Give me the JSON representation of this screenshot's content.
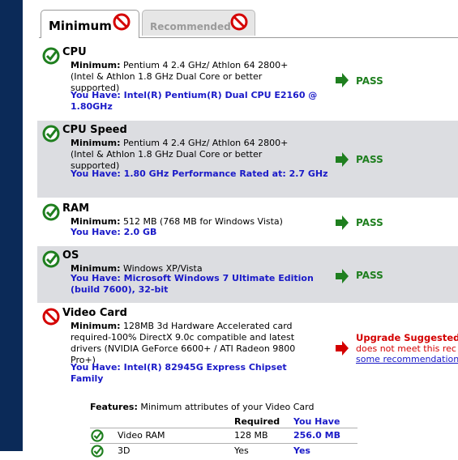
{
  "tabs": [
    {
      "label": "Minimum",
      "active": true,
      "icon": "no-icon"
    },
    {
      "label": "Recommended",
      "active": false,
      "icon": "no-icon"
    }
  ],
  "requirements": [
    {
      "title": "CPU",
      "status": "pass",
      "minimum_label": "Minimum:",
      "minimum_text": "Pentium 4 2.4 GHz/ Athlon 64 2800+ (Intel & Athlon 1.8 GHz Dual Core or better supported)",
      "have_text": "You Have: Intel(R) Pentium(R) Dual CPU E2160 @ 1.80GHz",
      "result": "PASS"
    },
    {
      "title": "CPU Speed",
      "status": "pass",
      "minimum_label": "Minimum:",
      "minimum_text": "Pentium 4 2.4 GHz/ Athlon 64 2800+ (Intel & Athlon 1.8 GHz Dual Core or better supported)",
      "have_text": "You Have: 1.80 GHz Performance Rated at: 2.7 GHz",
      "result": "PASS"
    },
    {
      "title": "RAM",
      "status": "pass",
      "minimum_label": "Minimum:",
      "minimum_text": "512 MB (768 MB for Windows Vista)",
      "have_text": "You Have: 2.0 GB",
      "result": "PASS"
    },
    {
      "title": "OS",
      "status": "pass",
      "minimum_label": "Minimum:",
      "minimum_text": "Windows XP/Vista",
      "have_text": "You Have: Microsoft Windows 7 Ultimate Edition (build 7600), 32-bit",
      "result": "PASS"
    },
    {
      "title": "Video Card",
      "status": "fail",
      "minimum_label": "Minimum:",
      "minimum_text": "128MB 3d Hardware Accelerated card required-100% DirectX 9.0c compatible and latest drivers (NVIDIA GeForce 6600+ / ATI Radeon 9800 Pro+)",
      "have_text": "You Have: Intel(R) 82945G Express Chipset Family",
      "upgrade_title": "Upgrade Suggested",
      "upgrade_text": "does not meet this rec",
      "upgrade_link": "some recommendation"
    }
  ],
  "features": {
    "label": "Features:",
    "description": "Minimum attributes of your Video Card",
    "col_required": "Required",
    "col_have": "You Have",
    "rows": [
      {
        "name": "Video RAM",
        "required": "128 MB",
        "have": "256.0 MB",
        "status": "pass"
      },
      {
        "name": "3D",
        "required": "Yes",
        "have": "Yes",
        "status": "pass"
      }
    ]
  },
  "colors": {
    "pass": "#1f7f1f",
    "fail": "#d40000",
    "link": "#1a1ac8",
    "sidebar": "#0b2a58",
    "row_gray": "#dcdde1"
  }
}
